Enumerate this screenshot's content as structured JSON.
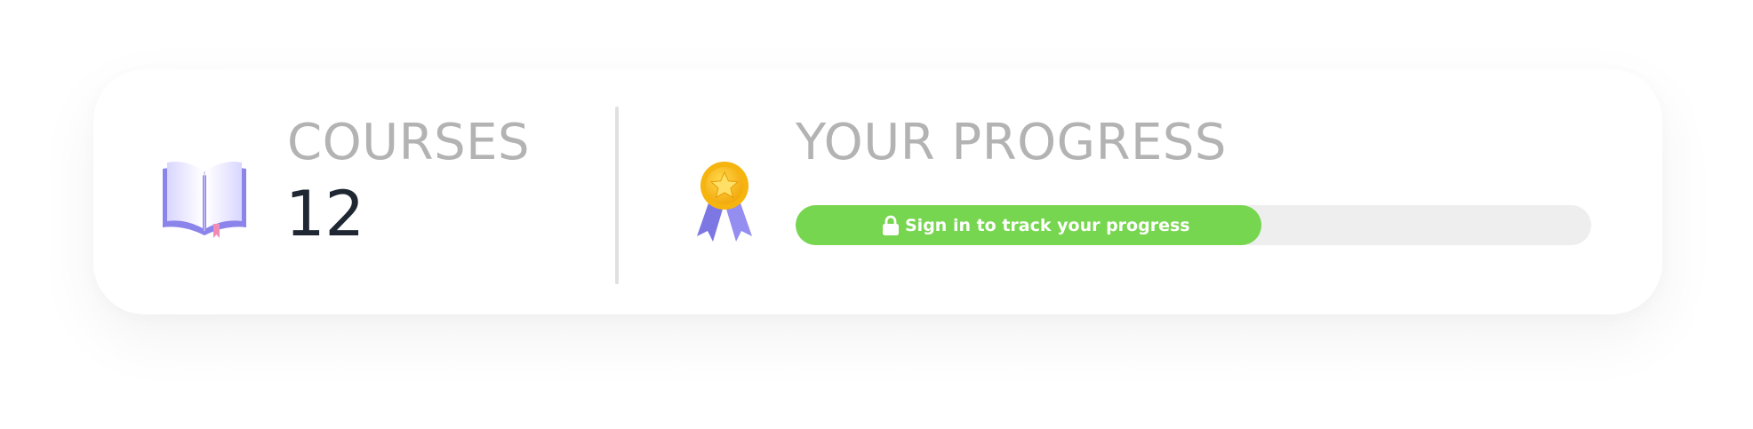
{
  "stats_card": {
    "courses": {
      "label": "COURSES",
      "count": "12",
      "icon": "book-icon"
    },
    "progress": {
      "label": "YOUR PROGRESS",
      "icon": "medal-icon",
      "bar": {
        "fill_fraction": 0.585,
        "text": "Sign in to track your progress",
        "icon": "lock-icon"
      }
    }
  },
  "colors": {
    "label_gray": "#b3b3b3",
    "count_dark": "#1f2733",
    "progress_fill": "#77d64f",
    "progress_track": "#eeeeee",
    "book_purple": "#8b84ea",
    "medal_gold": "#f6b40e",
    "ribbon_purple": "#7d77e3"
  }
}
